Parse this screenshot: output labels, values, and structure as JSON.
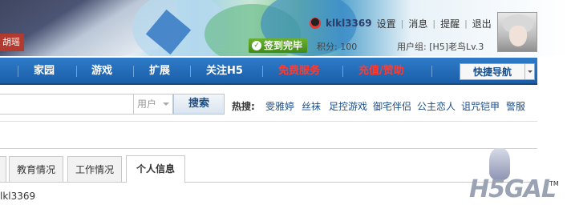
{
  "banner": {
    "sign_text": "胡瑶",
    "user": {
      "name": "klkl3369",
      "links": [
        "设置",
        "消息",
        "提醒",
        "退出"
      ]
    },
    "checkin_label": "签到完毕",
    "points_text": "积分: 100",
    "group_text": "用户组: [H5]老鸟Lv.3"
  },
  "nav": {
    "items": [
      {
        "label": "家园",
        "color": "#ffffff"
      },
      {
        "label": "游戏",
        "color": "#ffffff"
      },
      {
        "label": "扩展",
        "color": "#ffffff"
      },
      {
        "label": "关注H5",
        "color": "#ffffff"
      },
      {
        "label": "免费服务",
        "color": "#ff3b2f"
      },
      {
        "label": "充值/赞助",
        "color": "#ff3b2f"
      }
    ],
    "quick_nav_label": "快捷导航"
  },
  "search": {
    "input_value": "",
    "select_value": "用户",
    "button_label": "搜索",
    "hot_label": "热搜:",
    "hot_items": [
      "雯雅婷",
      "丝袜",
      "足控游戏",
      "御宅伴侣",
      "公主恋人",
      "诅咒铠甲",
      "警服"
    ]
  },
  "tabs": {
    "items": [
      "教育情况",
      "工作情况",
      "个人信息"
    ],
    "active": "个人信息"
  },
  "profile": {
    "value": "lkl3369"
  },
  "logo": {
    "text": "H5GAL",
    "tm": "TM"
  },
  "colors": {
    "nav_bg": "#1b5ea8",
    "checkin_green": "#3f8a18",
    "link_blue": "#1b4f8a",
    "nav_red": "#ff3b2f"
  }
}
